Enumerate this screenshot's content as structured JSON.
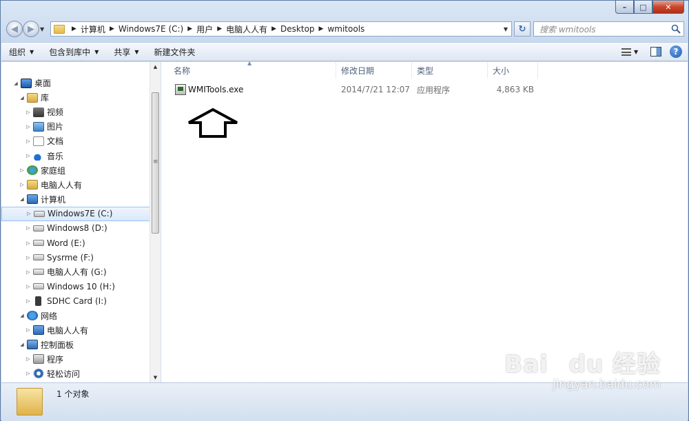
{
  "window": {
    "title_blurred": "",
    "buttons": {
      "minimize": "–",
      "maximize": "□",
      "close": "✕"
    }
  },
  "address": {
    "crumbs": [
      "计算机",
      "Windows7E (C:)",
      "用户",
      "电脑人人有",
      "Desktop",
      "wmitools"
    ],
    "search_placeholder": "搜索 wmitools"
  },
  "toolbar": {
    "organize": "组织",
    "include_library": "包含到库中",
    "share": "共享",
    "new_folder": "新建文件夹"
  },
  "nav_tree": [
    {
      "label": "桌面",
      "level": 0,
      "icon": "desktop-icon",
      "expanded": true
    },
    {
      "label": "库",
      "level": 1,
      "icon": "library-icon",
      "expanded": true
    },
    {
      "label": "视频",
      "level": 2,
      "icon": "video-icon"
    },
    {
      "label": "图片",
      "level": 2,
      "icon": "picture-icon"
    },
    {
      "label": "文档",
      "level": 2,
      "icon": "document-icon"
    },
    {
      "label": "音乐",
      "level": 2,
      "icon": "music-icon"
    },
    {
      "label": "家庭组",
      "level": 1,
      "icon": "homegroup-icon"
    },
    {
      "label": "电脑人人有",
      "level": 1,
      "icon": "user-folder-icon"
    },
    {
      "label": "计算机",
      "level": 1,
      "icon": "computer-icon",
      "expanded": true
    },
    {
      "label": "Windows7E (C:)",
      "level": 2,
      "icon": "system-drive-icon",
      "selected": true
    },
    {
      "label": "Windows8 (D:)",
      "level": 2,
      "icon": "drive-icon"
    },
    {
      "label": "Word (E:)",
      "level": 2,
      "icon": "drive-icon"
    },
    {
      "label": "Sysrme (F:)",
      "level": 2,
      "icon": "drive-icon"
    },
    {
      "label": "电脑人人有 (G:)",
      "level": 2,
      "icon": "drive-icon"
    },
    {
      "label": "Windows 10 (H:)",
      "level": 2,
      "icon": "drive-icon"
    },
    {
      "label": "SDHC Card (I:)",
      "level": 2,
      "icon": "sd-card-icon"
    },
    {
      "label": "网络",
      "level": 1,
      "icon": "network-icon",
      "expanded": true
    },
    {
      "label": "电脑人人有",
      "level": 2,
      "icon": "network-computer-icon"
    },
    {
      "label": "控制面板",
      "level": 1,
      "icon": "control-panel-icon",
      "expanded": true
    },
    {
      "label": "程序",
      "level": 2,
      "icon": "programs-icon"
    },
    {
      "label": "轻松访问",
      "level": 2,
      "icon": "ease-of-access-icon"
    }
  ],
  "columns": {
    "name": "名称",
    "date": "修改日期",
    "type": "类型",
    "size": "大小"
  },
  "files": [
    {
      "name": "WMITools.exe",
      "date": "2014/7/21 12:07",
      "type": "应用程序",
      "size": "4,863 KB",
      "icon": "exe-icon"
    }
  ],
  "status": {
    "count": "1 个对象"
  },
  "watermark": {
    "brand": "Bai du 经验",
    "url": "jingyan.baidu.com"
  }
}
